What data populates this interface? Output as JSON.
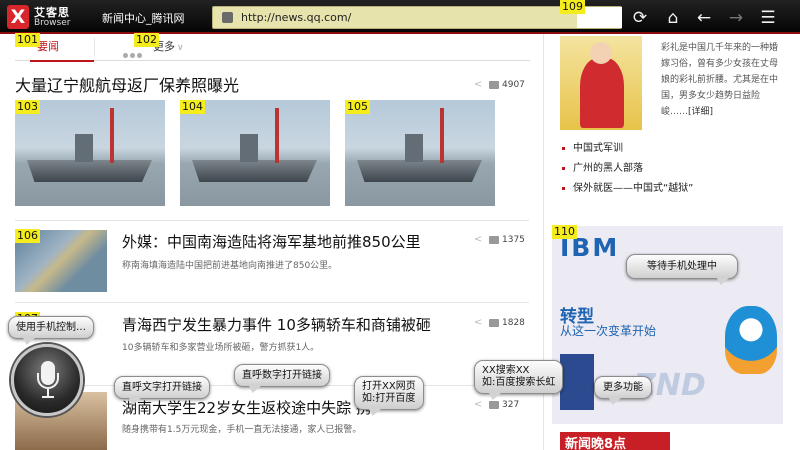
{
  "browser": {
    "logo_name": "艾客思",
    "logo_sub": "Browser",
    "page_title": "新闻中心_腾讯网",
    "url": "http://news.qq.com/",
    "icons": [
      "refresh-icon",
      "home-icon",
      "back-icon",
      "forward-icon"
    ]
  },
  "tabs": {
    "news": "要闻",
    "more": "更多"
  },
  "headline1": {
    "title": "大量辽宁舰航母返厂保养照曝光",
    "comments": "4907"
  },
  "articles": [
    {
      "title": "外媒：中国南海造陆将海军基地前推850公里",
      "sub": "称南海填海造陆中国把前进基地向南推进了850公里。",
      "comments": "1375"
    },
    {
      "title": "青海西宁发生暴力事件 10多辆轿车和商铺被砸",
      "sub": "10多辆轿车和多家营业场所被砸，警方抓获1人。",
      "comments": "1828"
    },
    {
      "title": "湖南大学生22岁女生返校途中失踪 携",
      "sub": "随身携带有1.5万元现金，手机一直无法接通，家人已报警。",
      "comments": "327"
    }
  ],
  "sidebar": {
    "desc": "彩礼是中国几千年来的一种婚嫁习俗，曾有多少女孩在丈母娘的彩礼前折腰。尤其是在中国，男多女少趋势日益险峻……",
    "detail_link": "[详细]",
    "items": [
      "中国式军训",
      "广州的黑人部落",
      "保外就医——中国式“越狱”"
    ]
  },
  "ad": {
    "brand": "IBM",
    "big": "转型",
    "small": "从这一次变革开始",
    "watermark": "ZND"
  },
  "bottom_banner": "新闻晚8点",
  "badges": [
    "101",
    "102",
    "103",
    "104",
    "105",
    "106",
    "107",
    "109",
    "110"
  ],
  "voice_hints": [
    "使用手机控制…",
    "等待手机处理中",
    "直呼文字打开链接",
    "直呼数字打开链接",
    "打开XX网页\n如:打开百度",
    "XX搜索XX\n如:百度搜索长虹",
    "更多功能"
  ],
  "colors": {
    "accent": "#c0141b",
    "badge": "#f4ec1c",
    "urlbar": "#e7e3ad"
  }
}
